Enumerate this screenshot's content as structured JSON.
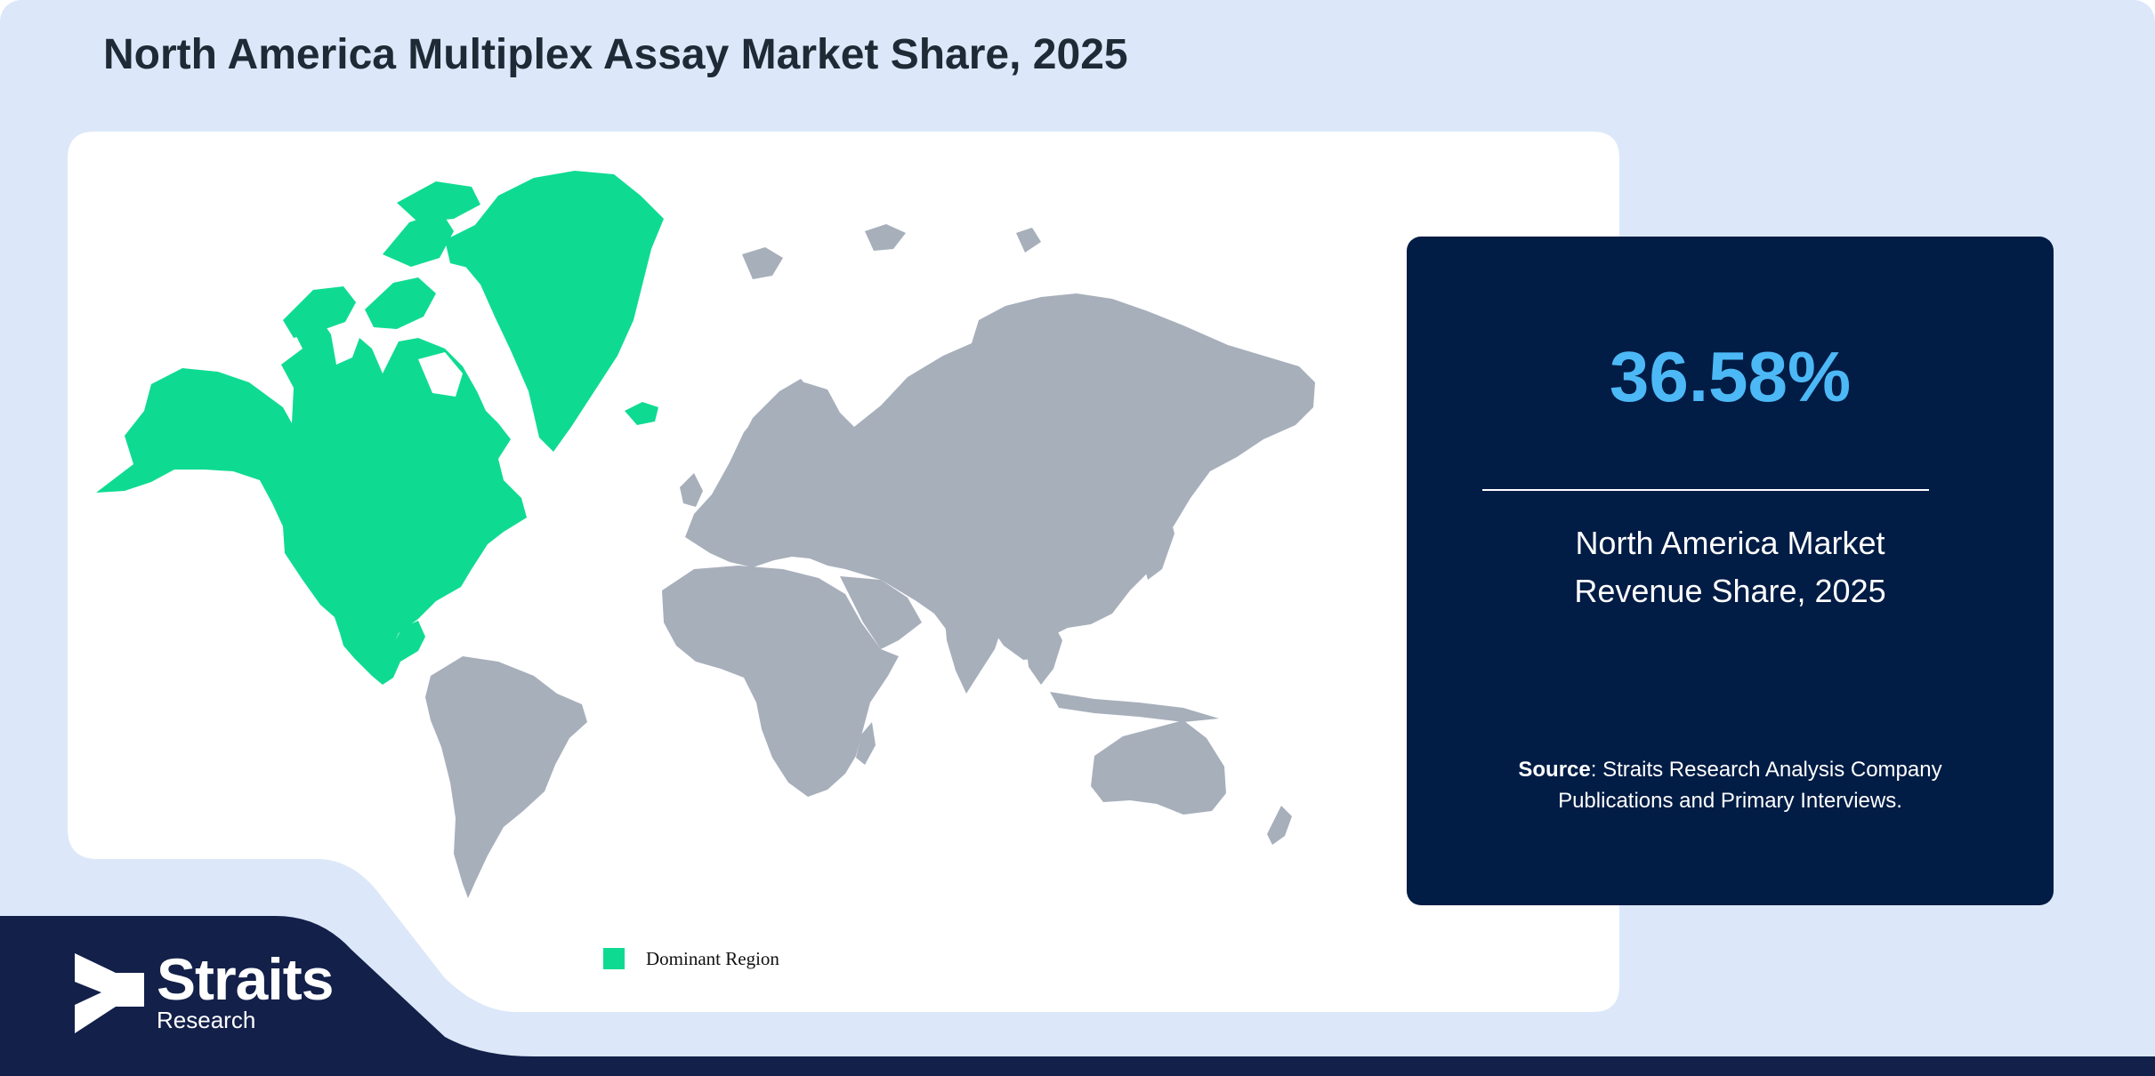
{
  "title": "North America Multiplex Assay Market Share, 2025",
  "highlight_region": "North America",
  "stat": {
    "value": "36.58%",
    "label_line1": "North America Market",
    "label_line2": "Revenue Share, 2025"
  },
  "source": {
    "prefix": "Source",
    "line1_rest": ": Straits Research Analysis Company",
    "line2": "Publications and Primary Interviews."
  },
  "legend": {
    "label": "Dominant Region"
  },
  "logo": {
    "name": "Straits",
    "sub": "Research"
  },
  "colors": {
    "background": "#dce8f9",
    "dominant_region": "#0edb91",
    "other_regions": "#a7afbb",
    "panel": "#011c45",
    "stat_value": "#4cb9f6",
    "footer": "#13204a"
  }
}
